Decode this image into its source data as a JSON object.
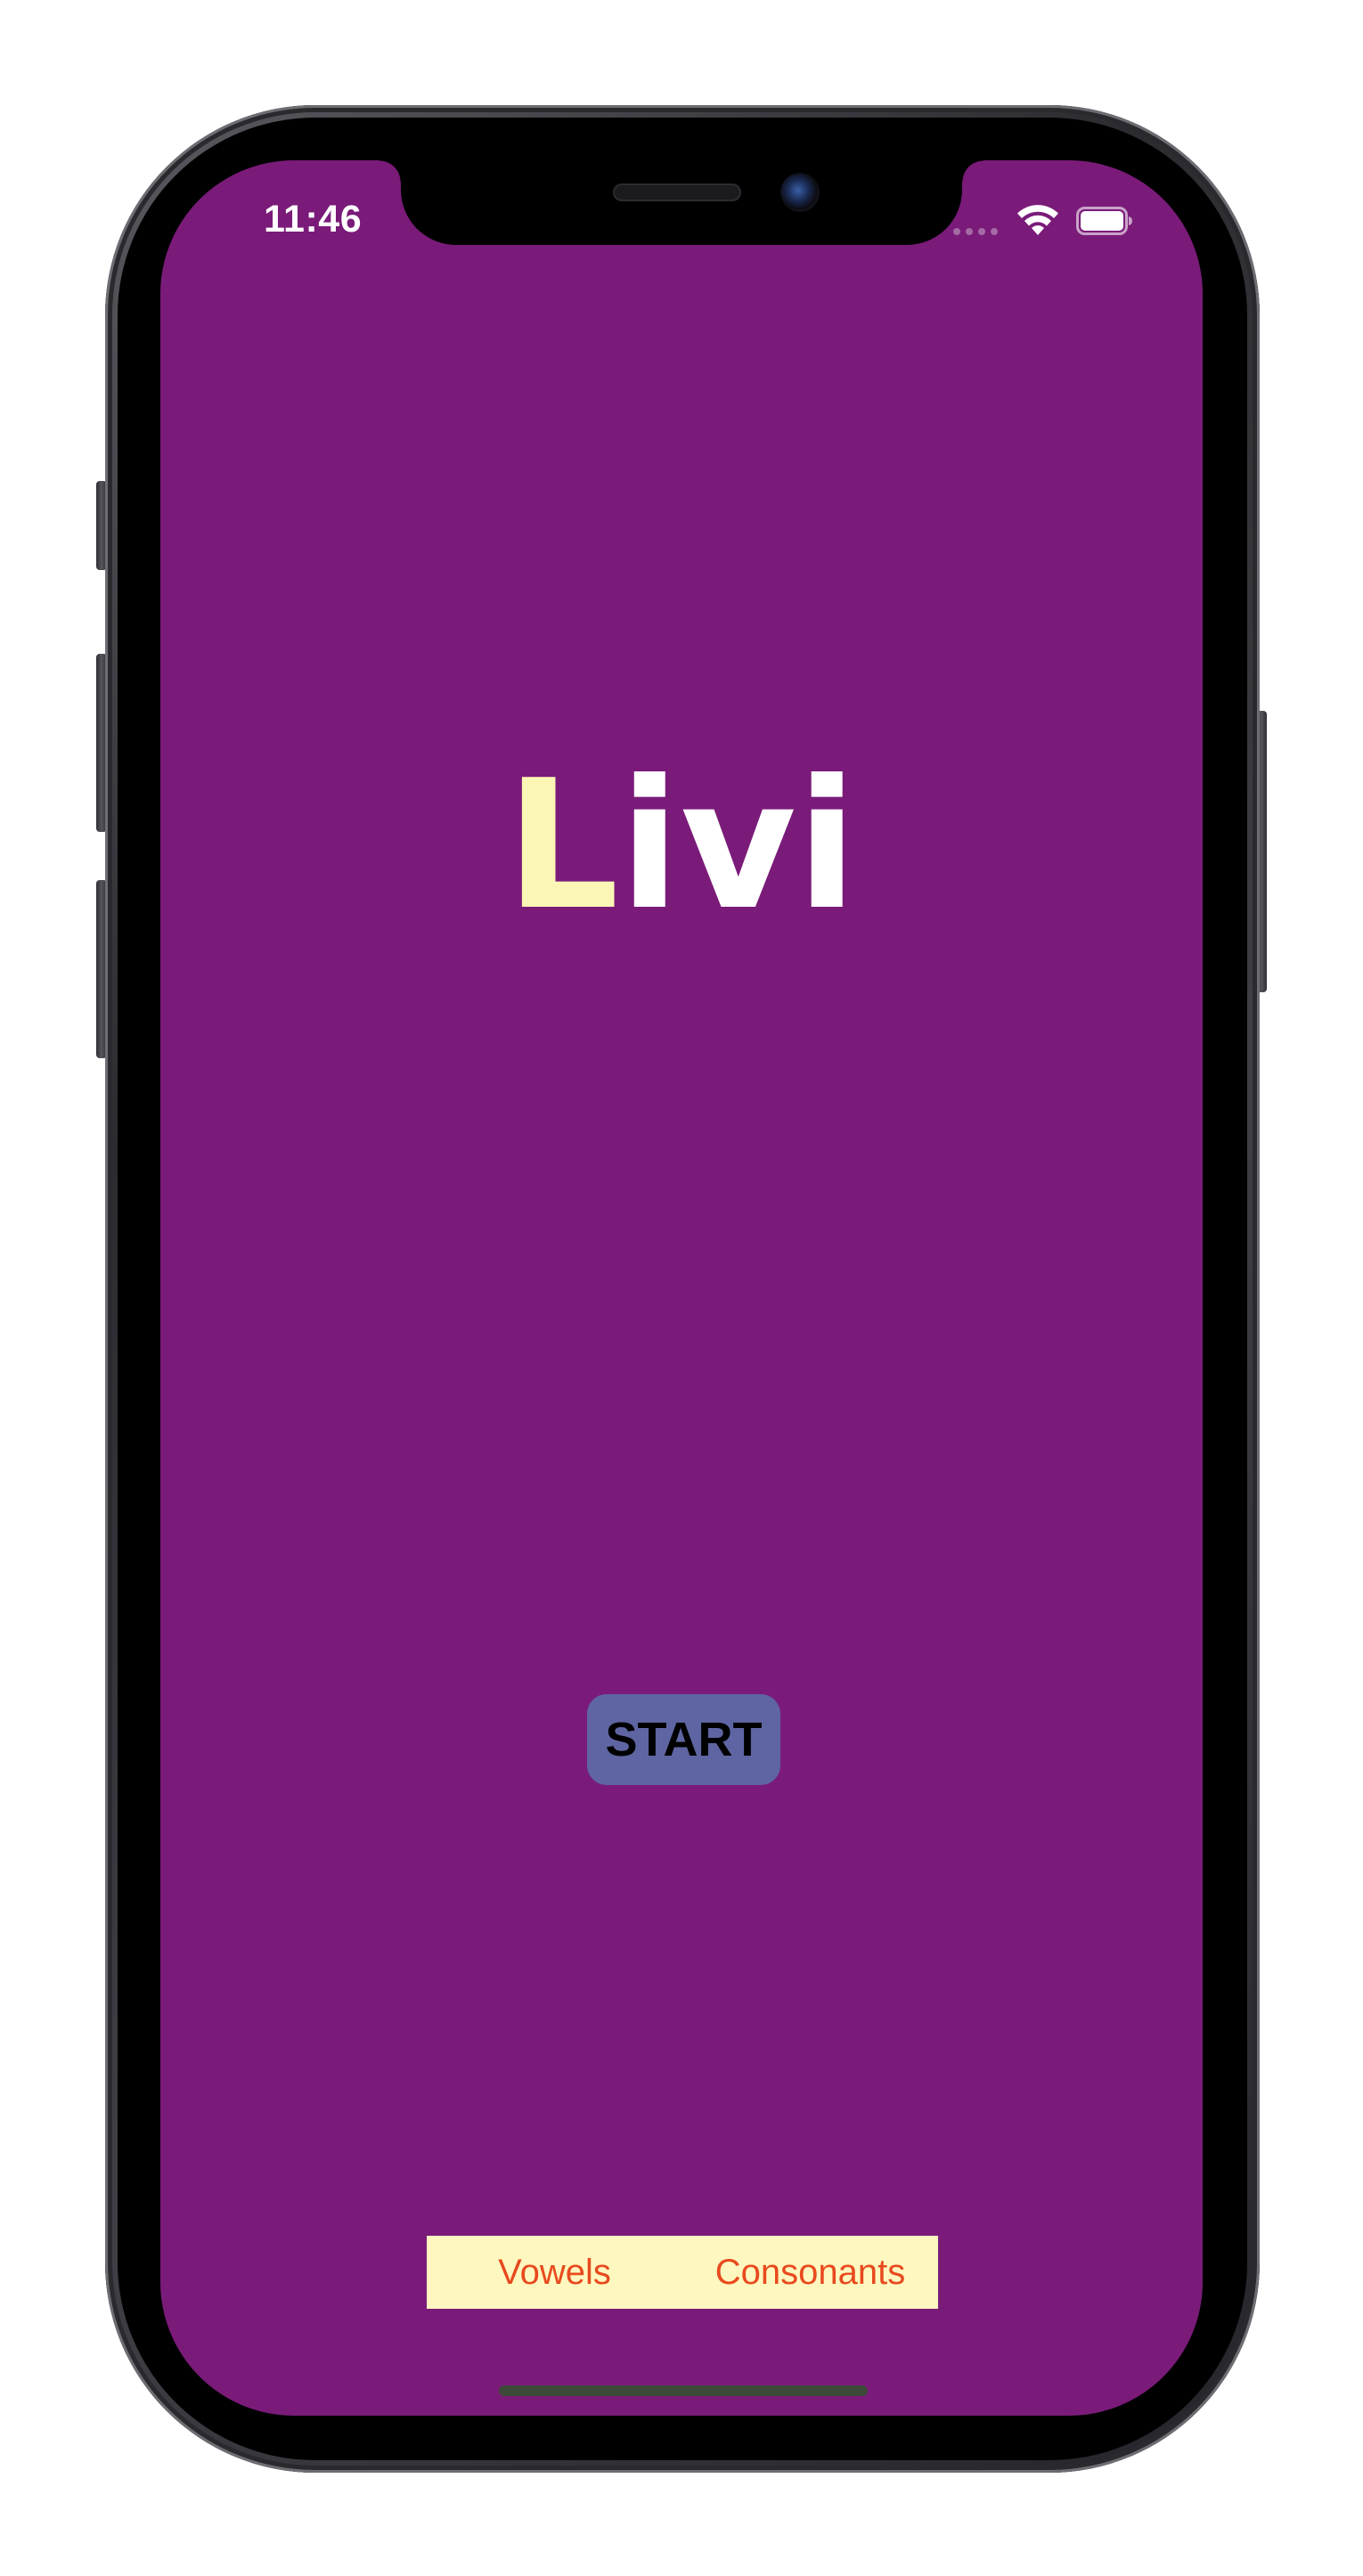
{
  "status_bar": {
    "time": "11:46"
  },
  "app": {
    "title_first": "L",
    "title_rest": "ivi",
    "background_color": "#7a1b79",
    "start_label": "START",
    "segments": [
      {
        "label": "Vowels"
      },
      {
        "label": "Consonants"
      }
    ]
  },
  "icons": {
    "wifi": "wifi-icon",
    "battery": "battery-icon",
    "signal": "signal-dots-icon"
  }
}
